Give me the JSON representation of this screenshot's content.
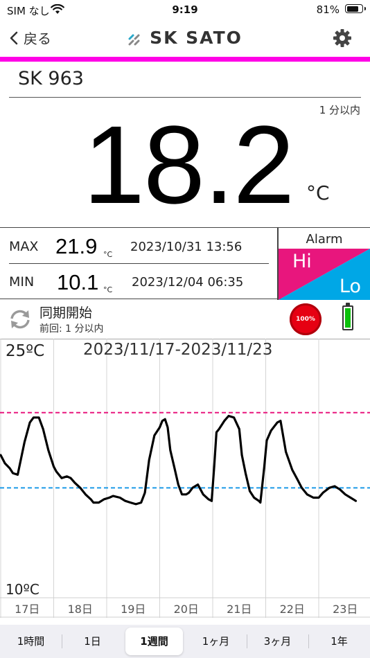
{
  "status": {
    "carrier": "SIM なし",
    "time": "9:19",
    "battery_percent": "81%",
    "battery_level": 0.81
  },
  "nav": {
    "back_label": "戻る",
    "brand": "SK SATO",
    "settings_icon": "gear-icon"
  },
  "device": {
    "name": "SK 963",
    "update_status": "1 分以内",
    "temperature": "18.2",
    "unit": "°C"
  },
  "minmax": {
    "max": {
      "label": "MAX",
      "value": "21.9",
      "unit": "°C",
      "datetime": "2023/10/31 13:56"
    },
    "min": {
      "label": "MIN",
      "value": "10.1",
      "unit": "°C",
      "datetime": "2023/12/04 06:35"
    }
  },
  "alarm": {
    "title": "Alarm",
    "hi": "Hi",
    "lo": "Lo",
    "hi_color": "#e8167d",
    "lo_color": "#00a7e6"
  },
  "sync": {
    "title": "同期開始",
    "last": "前回: 1 分以内",
    "signal_label": "100%",
    "battery_level": 1.0
  },
  "chart_data": {
    "type": "line",
    "date_range": "2023/11/17-2023/11/23",
    "y_max_label": "25ºC",
    "y_min_label": "10ºC",
    "ylim": [
      10,
      25
    ],
    "grid": true,
    "x_labels": [
      "17日",
      "18日",
      "19日",
      "20日",
      "21日",
      "22日",
      "23日"
    ],
    "thresholds": {
      "high": 20.9,
      "low": 16.3,
      "high_color": "#e8167d",
      "low_color": "#1c9ae8"
    },
    "series": [
      {
        "x": [
          17.0,
          17.08,
          17.17,
          17.23,
          17.32,
          17.45,
          17.55,
          17.62,
          17.72,
          17.8,
          17.9,
          18.0,
          18.05,
          18.15,
          18.25,
          18.32,
          18.4,
          18.5,
          18.6,
          18.7,
          18.75,
          18.85,
          18.95,
          19.05,
          19.12,
          19.25,
          19.35,
          19.45,
          19.55,
          19.65,
          19.72,
          19.8,
          19.9,
          20.0,
          20.05,
          20.1,
          20.15,
          20.2,
          20.28,
          20.35,
          20.42,
          20.5,
          20.55,
          20.62,
          20.72,
          20.82,
          20.92,
          20.98,
          21.03,
          21.07,
          21.12,
          21.22,
          21.3,
          21.4,
          21.5,
          21.55,
          21.62,
          21.7,
          21.78,
          21.87,
          21.9,
          21.97,
          22.02,
          22.1,
          22.22,
          22.28,
          22.38,
          22.5,
          22.6,
          22.68,
          22.78,
          22.9,
          23.0,
          23.08,
          23.2,
          23.3,
          23.4,
          23.5,
          23.6,
          23.7
        ],
        "y": [
          18.3,
          17.8,
          17.5,
          17.2,
          17.1,
          19.1,
          20.3,
          20.6,
          20.6,
          19.9,
          18.6,
          17.6,
          17.3,
          16.9,
          17.0,
          16.9,
          16.6,
          16.3,
          15.9,
          15.6,
          15.4,
          15.4,
          15.6,
          15.7,
          15.8,
          15.7,
          15.5,
          15.4,
          15.3,
          15.4,
          16.0,
          18.0,
          19.5,
          20.0,
          20.4,
          20.5,
          20.0,
          18.6,
          17.5,
          16.5,
          15.9,
          15.9,
          16.0,
          16.3,
          16.5,
          15.9,
          15.6,
          15.5,
          17.7,
          19.7,
          19.9,
          20.4,
          20.7,
          20.6,
          19.9,
          18.3,
          17.2,
          16.1,
          15.7,
          15.5,
          15.4,
          17.5,
          19.2,
          19.8,
          20.3,
          20.4,
          18.5,
          17.4,
          16.8,
          16.3,
          15.9,
          15.7,
          15.7,
          16.0,
          16.3,
          16.4,
          16.2,
          15.9,
          15.7,
          15.5
        ]
      }
    ]
  },
  "tabs": [
    {
      "label": "1時間",
      "active": false
    },
    {
      "label": "1日",
      "active": false
    },
    {
      "label": "1週間",
      "active": true
    },
    {
      "label": "1ヶ月",
      "active": false
    },
    {
      "label": "3ヶ月",
      "active": false
    },
    {
      "label": "1年",
      "active": false
    }
  ]
}
